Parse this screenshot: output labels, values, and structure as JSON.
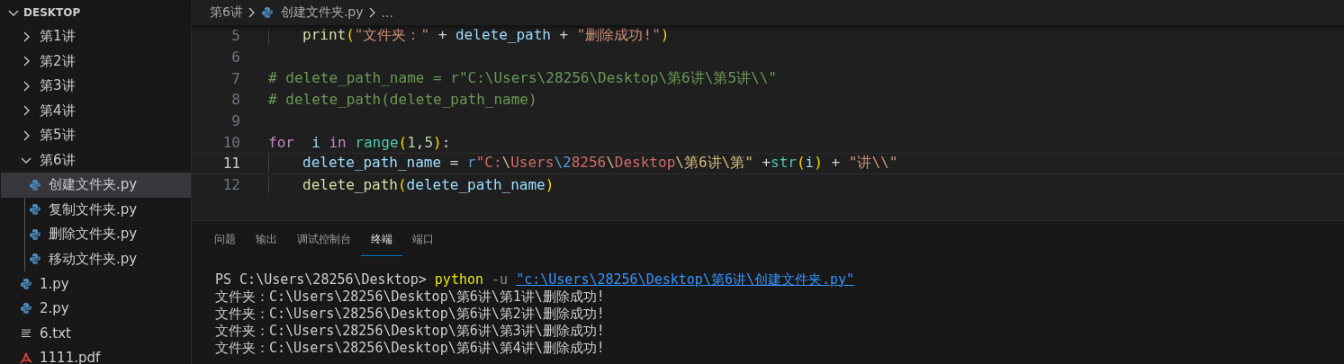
{
  "explorer": {
    "title": "DESKTOP",
    "expanded": true,
    "items": [
      {
        "label": "第1讲",
        "kind": "folder",
        "expanded": false,
        "selected": false
      },
      {
        "label": "第2讲",
        "kind": "folder",
        "expanded": false,
        "selected": false
      },
      {
        "label": "第3讲",
        "kind": "folder",
        "expanded": false,
        "selected": false
      },
      {
        "label": "第4讲",
        "kind": "folder",
        "expanded": false,
        "selected": false
      },
      {
        "label": "第5讲",
        "kind": "folder",
        "expanded": false,
        "selected": false
      },
      {
        "label": "第6讲",
        "kind": "folder",
        "expanded": true,
        "selected": false,
        "children": [
          {
            "label": "创建文件夹.py",
            "kind": "python",
            "selected": true
          },
          {
            "label": "复制文件夹.py",
            "kind": "python",
            "selected": false
          },
          {
            "label": "删除文件夹.py",
            "kind": "python",
            "selected": false
          },
          {
            "label": "移动文件夹.py",
            "kind": "python",
            "selected": false
          }
        ]
      },
      {
        "label": "1.py",
        "kind": "python",
        "selected": false
      },
      {
        "label": "2.py",
        "kind": "python",
        "selected": false
      },
      {
        "label": "6.txt",
        "kind": "text",
        "selected": false
      },
      {
        "label": "1111.pdf",
        "kind": "pdf",
        "selected": false
      }
    ]
  },
  "breadcrumb": [
    {
      "label": "第6讲",
      "kind": "folder"
    },
    {
      "label": "创建文件夹.py",
      "kind": "python"
    },
    {
      "label": "...",
      "kind": "more"
    }
  ],
  "code_lines": [
    {
      "number": "5",
      "current": false,
      "indented": true,
      "tokens": [
        {
          "kind": "func",
          "text": "print"
        },
        {
          "kind": "bracket",
          "text": "("
        },
        {
          "kind": "string",
          "text": "\"文件夹：\""
        },
        {
          "kind": "plain",
          "text": " + "
        },
        {
          "kind": "var",
          "text": "delete_path"
        },
        {
          "kind": "plain",
          "text": " + "
        },
        {
          "kind": "string",
          "text": "\"删除成功!\""
        },
        {
          "kind": "bracket",
          "text": ")"
        }
      ]
    },
    {
      "number": "6",
      "current": false
    },
    {
      "number": "7",
      "current": false,
      "tokens": [
        {
          "kind": "comment",
          "text": "# delete_path_name = r\"C:\\Users\\28256\\Desktop\\第6讲\\第5讲\\\\\""
        }
      ]
    },
    {
      "number": "8",
      "current": false,
      "tokens": [
        {
          "kind": "comment",
          "text": "# delete_path(delete_path_name)"
        }
      ]
    },
    {
      "number": "9",
      "current": false
    },
    {
      "number": "10",
      "current": false,
      "tokens": [
        {
          "kind": "keyword",
          "text": "for"
        },
        {
          "kind": "var",
          "text": "  i"
        },
        {
          "kind": "keyword",
          "text": " in"
        },
        {
          "kind": "type",
          "text": " range"
        },
        {
          "kind": "bracket",
          "text": "("
        },
        {
          "kind": "number",
          "text": "1"
        },
        {
          "kind": "plain",
          "text": ","
        },
        {
          "kind": "number",
          "text": "5"
        },
        {
          "kind": "bracket",
          "text": ")"
        },
        {
          "kind": "plain",
          "text": ":"
        }
      ]
    },
    {
      "number": "11",
      "current": true,
      "indented": true,
      "tokens": [
        {
          "kind": "var",
          "text": "delete_path_name"
        },
        {
          "kind": "plain",
          "text": " = "
        },
        {
          "kind": "prefix",
          "text": "r"
        },
        {
          "kind": "regex",
          "text": "\"C:"
        },
        {
          "kind": "escape",
          "text": "\\"
        },
        {
          "kind": "regex",
          "text": "Users"
        },
        {
          "kind": "prefix",
          "text": "\\2"
        },
        {
          "kind": "regex",
          "text": "8256"
        },
        {
          "kind": "escape",
          "text": "\\"
        },
        {
          "kind": "regex",
          "text": "Desktop"
        },
        {
          "kind": "escape",
          "text": "\\第6讲\\第\""
        },
        {
          "kind": "plain",
          "text": " +"
        },
        {
          "kind": "type",
          "text": "str"
        },
        {
          "kind": "bracket",
          "text": "("
        },
        {
          "kind": "var",
          "text": "i"
        },
        {
          "kind": "bracket",
          "text": ")"
        },
        {
          "kind": "plain",
          "text": " + "
        },
        {
          "kind": "string",
          "text": "\"讲\\\\\""
        }
      ]
    },
    {
      "number": "12",
      "current": false,
      "indented": true,
      "tokens": [
        {
          "kind": "func",
          "text": "delete_path"
        },
        {
          "kind": "bracket",
          "text": "("
        },
        {
          "kind": "var",
          "text": "delete_path_name"
        },
        {
          "kind": "bracket",
          "text": ")"
        }
      ]
    }
  ],
  "panel_tabs": [
    {
      "label": "问题",
      "selected": false
    },
    {
      "label": "输出",
      "selected": false
    },
    {
      "label": "调试控制台",
      "selected": false
    },
    {
      "label": "终端",
      "selected": true
    },
    {
      "label": "端口",
      "selected": false
    }
  ],
  "terminal_lines": [
    [
      {
        "kind": "plain",
        "text": "PS C:\\Users\\28256\\Desktop> "
      },
      {
        "kind": "command",
        "text": "python"
      },
      {
        "kind": "flag",
        "text": " -u "
      },
      {
        "kind": "link",
        "text": "\"c:\\Users\\28256\\Desktop\\第6讲\\创建文件夹.py\""
      }
    ],
    [
      {
        "kind": "plain",
        "text": "文件夹：C:\\Users\\28256\\Desktop\\第6讲\\第1讲\\删除成功!"
      }
    ],
    [
      {
        "kind": "plain",
        "text": "文件夹：C:\\Users\\28256\\Desktop\\第6讲\\第2讲\\删除成功!"
      }
    ],
    [
      {
        "kind": "plain",
        "text": "文件夹：C:\\Users\\28256\\Desktop\\第6讲\\第3讲\\删除成功!"
      }
    ],
    [
      {
        "kind": "plain",
        "text": "文件夹：C:\\Users\\28256\\Desktop\\第6讲\\第4讲\\删除成功!"
      }
    ]
  ]
}
